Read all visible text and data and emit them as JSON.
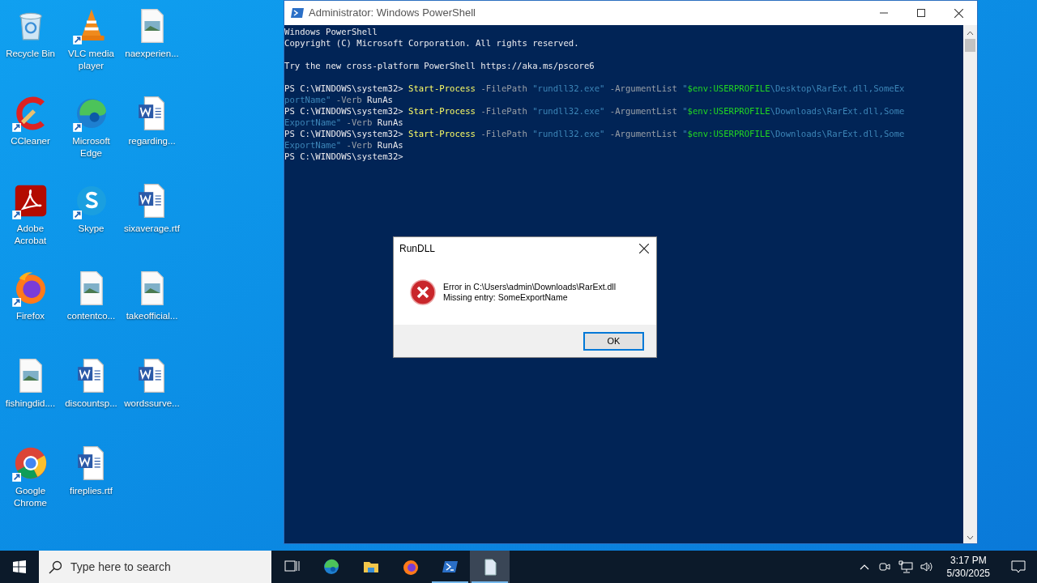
{
  "desktop_icons": [
    {
      "label": "Recycle Bin",
      "kind": "recycle",
      "shortcut": false
    },
    {
      "label": "VLC media player",
      "kind": "vlc",
      "shortcut": true
    },
    {
      "label": "naexperien...",
      "kind": "image",
      "shortcut": false
    },
    {
      "label": "CCleaner",
      "kind": "ccleaner",
      "shortcut": true
    },
    {
      "label": "Microsoft Edge",
      "kind": "edge",
      "shortcut": true
    },
    {
      "label": "regarding...",
      "kind": "word",
      "shortcut": false
    },
    {
      "label": "Adobe Acrobat",
      "kind": "acrobat",
      "shortcut": true
    },
    {
      "label": "Skype",
      "kind": "skype",
      "shortcut": true
    },
    {
      "label": "sixaverage.rtf",
      "kind": "word",
      "shortcut": false
    },
    {
      "label": "Firefox",
      "kind": "firefox",
      "shortcut": true
    },
    {
      "label": "contentco...",
      "kind": "image",
      "shortcut": false
    },
    {
      "label": "takeofficial...",
      "kind": "image",
      "shortcut": false
    },
    {
      "label": "fishingdid....",
      "kind": "image",
      "shortcut": false
    },
    {
      "label": "discountsp...",
      "kind": "word",
      "shortcut": false
    },
    {
      "label": "wordssurve...",
      "kind": "word",
      "shortcut": false
    },
    {
      "label": "Google Chrome",
      "kind": "chrome",
      "shortcut": true
    },
    {
      "label": "fireplies.rtf",
      "kind": "word",
      "shortcut": false
    }
  ],
  "console_window": {
    "title": "Administrator: Windows PowerShell",
    "lines": [
      [
        {
          "text": "Windows PowerShell",
          "kind": "plain"
        }
      ],
      [
        {
          "text": "Copyright (C) Microsoft Corporation. All rights reserved.",
          "kind": "plain"
        }
      ],
      [
        {
          "text": "Try the new cross-platform PowerShell https://aka.ms/pscore6",
          "kind": "plain",
          "gap_before": true
        }
      ],
      [
        {
          "text": "PS C:\\WINDOWS\\system32> ",
          "kind": "plain",
          "gap_before": true
        },
        {
          "text": "Start-Process",
          "kind": "command"
        },
        {
          "text": " -FilePath ",
          "kind": "param"
        },
        {
          "text": "\"rundll32.exe\"",
          "kind": "string"
        },
        {
          "text": " -ArgumentList ",
          "kind": "param"
        },
        {
          "text": "\"",
          "kind": "string"
        },
        {
          "text": "$env:USERPROFILE",
          "kind": "variable"
        },
        {
          "text": "\\Desktop\\RarExt.dll,SomeEx",
          "kind": "string"
        }
      ],
      [
        {
          "text": "portName\"",
          "kind": "string"
        },
        {
          "text": " -Verb ",
          "kind": "param"
        },
        {
          "text": "RunAs",
          "kind": "plain"
        }
      ],
      [
        {
          "text": "PS C:\\WINDOWS\\system32> ",
          "kind": "plain"
        },
        {
          "text": "Start-Process",
          "kind": "command"
        },
        {
          "text": " -FilePath ",
          "kind": "param"
        },
        {
          "text": "\"rundll32.exe\"",
          "kind": "string"
        },
        {
          "text": " -ArgumentList ",
          "kind": "param"
        },
        {
          "text": "\"",
          "kind": "string"
        },
        {
          "text": "$env:USERPROFILE",
          "kind": "variable"
        },
        {
          "text": "\\Downloads\\RarExt.dll,Some",
          "kind": "string"
        }
      ],
      [
        {
          "text": "ExportName\"",
          "kind": "string"
        },
        {
          "text": " -Verb ",
          "kind": "param"
        },
        {
          "text": "RunAs",
          "kind": "plain"
        }
      ],
      [
        {
          "text": "PS C:\\WINDOWS\\system32> ",
          "kind": "plain"
        },
        {
          "text": "Start-Process",
          "kind": "command"
        },
        {
          "text": " -FilePath ",
          "kind": "param"
        },
        {
          "text": "\"rundll32.exe\"",
          "kind": "string"
        },
        {
          "text": " -ArgumentList ",
          "kind": "param"
        },
        {
          "text": "\"",
          "kind": "string"
        },
        {
          "text": "$env:USERPROFILE",
          "kind": "variable"
        },
        {
          "text": "\\Downloads\\RarExt.dll,Some",
          "kind": "string"
        }
      ],
      [
        {
          "text": "ExportName\"",
          "kind": "string"
        },
        {
          "text": " -Verb ",
          "kind": "param"
        },
        {
          "text": "RunAs",
          "kind": "plain"
        }
      ],
      [
        {
          "text": "PS C:\\WINDOWS\\system32>",
          "kind": "plain"
        }
      ]
    ]
  },
  "dialog": {
    "title": "RunDLL",
    "message": [
      "Error in C:\\Users\\admin\\Downloads\\RarExt.dll",
      "Missing entry: SomeExportName"
    ],
    "button": "OK"
  },
  "taskbar": {
    "search_placeholder": "Type here to search",
    "apps": [
      {
        "kind": "taskview",
        "running": false,
        "selected": false
      },
      {
        "kind": "edge",
        "running": false,
        "selected": false
      },
      {
        "kind": "explorer",
        "running": false,
        "selected": false
      },
      {
        "kind": "firefox",
        "running": false,
        "selected": false
      },
      {
        "kind": "powershell",
        "running": true,
        "selected": false
      },
      {
        "kind": "file",
        "running": true,
        "selected": true
      }
    ],
    "time": "3:17 PM",
    "date": "5/30/2025"
  }
}
